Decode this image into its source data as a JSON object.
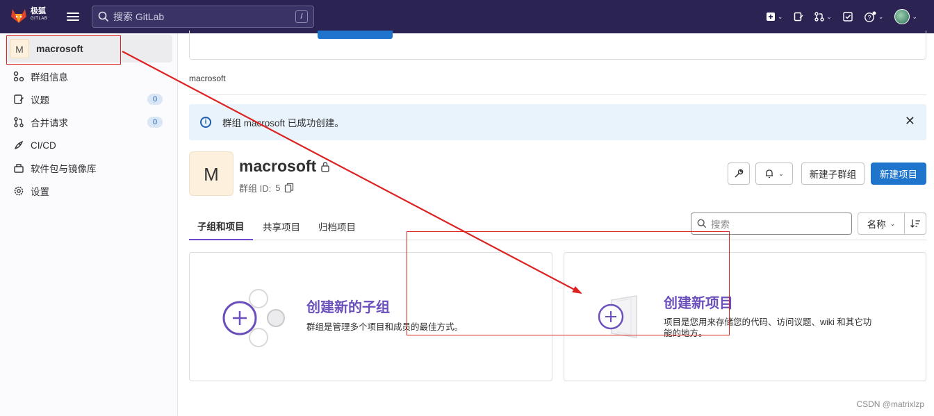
{
  "topbar": {
    "logo_text": "极狐",
    "logo_sub": "GITLAB",
    "search_placeholder": "搜索 GitLab",
    "search_shortcut": "/"
  },
  "sidebar": {
    "group_avatar_letter": "M",
    "group_name": "macrosoft",
    "items": [
      {
        "label": "群组信息",
        "icon": "group-info-icon"
      },
      {
        "label": "议题",
        "icon": "issues-icon",
        "count": "0"
      },
      {
        "label": "合并请求",
        "icon": "merge-request-icon",
        "count": "0"
      },
      {
        "label": "CI/CD",
        "icon": "rocket-icon"
      },
      {
        "label": "软件包与镜像库",
        "icon": "package-icon"
      },
      {
        "label": "设置",
        "icon": "gear-icon"
      }
    ]
  },
  "main": {
    "breadcrumb": "macrosoft",
    "alert": {
      "message": "群组 macrosoft 已成功创建。"
    },
    "group": {
      "avatar_letter": "M",
      "name": "macrosoft",
      "id_label": "群组 ID:",
      "id_value": "5"
    },
    "buttons": {
      "new_subgroup": "新建子群组",
      "new_project": "新建项目"
    },
    "tabs": [
      "子组和项目",
      "共享项目",
      "归档项目"
    ],
    "filter": {
      "search_placeholder": "搜索",
      "sort_label": "名称"
    },
    "cards": {
      "subgroup": {
        "title": "创建新的子组",
        "description": "群组是管理多个项目和成员的最佳方式。"
      },
      "project": {
        "title": "创建新项目",
        "description_line1": "项目是您用来存储您的代码、访问议题、wiki 和其它功",
        "description_line2": "能的地方。"
      }
    }
  },
  "watermark": "CSDN @matrixlzp",
  "colors": {
    "navbar": "#2b2352",
    "primary": "#1f75cb",
    "accent_purple": "#6b4fbb",
    "annotation_red": "#d22222"
  }
}
